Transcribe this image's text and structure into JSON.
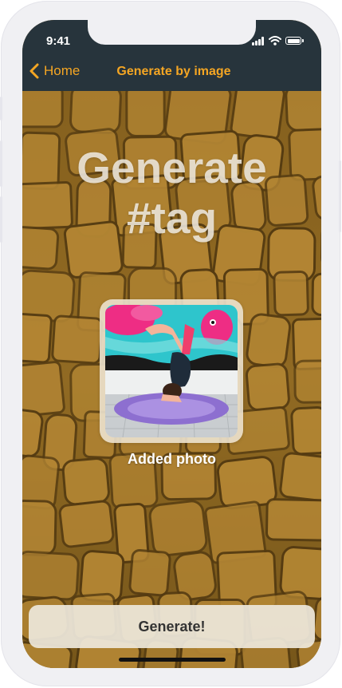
{
  "status_bar": {
    "time": "9:41"
  },
  "nav": {
    "back_label": "Home",
    "title": "Generate by image"
  },
  "hero": {
    "line1": "Generate",
    "line2": "#tag"
  },
  "photo": {
    "caption": "Added photo"
  },
  "actions": {
    "generate_label": "Generate!"
  },
  "colors": {
    "accent": "#f5a623",
    "nav_background": "#27343c",
    "button_background": "#ede7da"
  },
  "icons": [
    "cellular-signal-icon",
    "wifi-icon",
    "battery-icon",
    "chevron-left-icon"
  ]
}
